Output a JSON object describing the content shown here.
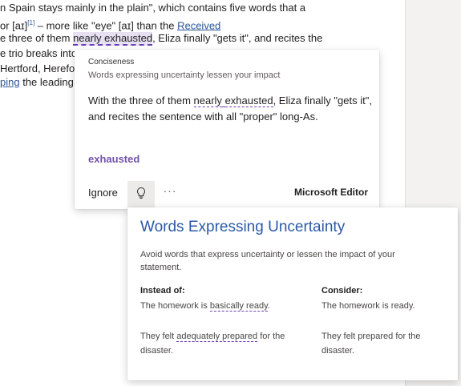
{
  "document": {
    "line1": "n Spain stays mainly in the plain\", which contains five words that a",
    "line2_a": "or [aɪ]",
    "line2_sup": "[1]",
    "line2_b": " – more like \"eye\" [aɪ] than the ",
    "line2_link": "Received",
    "line3_a": "e three of them ",
    "line3_flag": "nearly exhausted",
    "line3_b": ", Eliza finally \"gets it\", and recites the",
    "line4": "e trio breaks into",
    "line5": "Hertford, Herefor",
    "line6_link": "ping",
    "line6_b": " the leading"
  },
  "editor_card": {
    "category": "Conciseness",
    "subtitle": "Words expressing uncertainty lessen your impact",
    "context_a": "With the three of them ",
    "context_sq1": "nearly",
    "context_sp": " ",
    "context_sq2": "exhausted",
    "context_b": ", Eliza finally \"gets it\", and recites the sentence with all \"proper\" long-As.",
    "suggestion": "exhausted",
    "ignore_label": "Ignore",
    "more_label": "···",
    "brand": "Microsoft Editor",
    "bulb_icon": "lightbulb-icon"
  },
  "explanation": {
    "title": "Words Expressing Uncertainty",
    "description": "Avoid words that express uncertainty or lessen the impact of your statement.",
    "instead_header": "Instead of:",
    "consider_header": "Consider:",
    "ex1_instead_a": "The homework is ",
    "ex1_instead_sq": "basically ready",
    "ex1_instead_b": ".",
    "ex1_consider": "The homework is ready.",
    "ex2_instead_a": "They felt ",
    "ex2_instead_sq": "adequately prepared",
    "ex2_instead_b": " for the disaster.",
    "ex2_consider": "They felt prepared for the disaster."
  },
  "colors": {
    "accent_purple": "#7252aa",
    "title_blue": "#2b5aa8",
    "link_blue": "#2b579a"
  }
}
